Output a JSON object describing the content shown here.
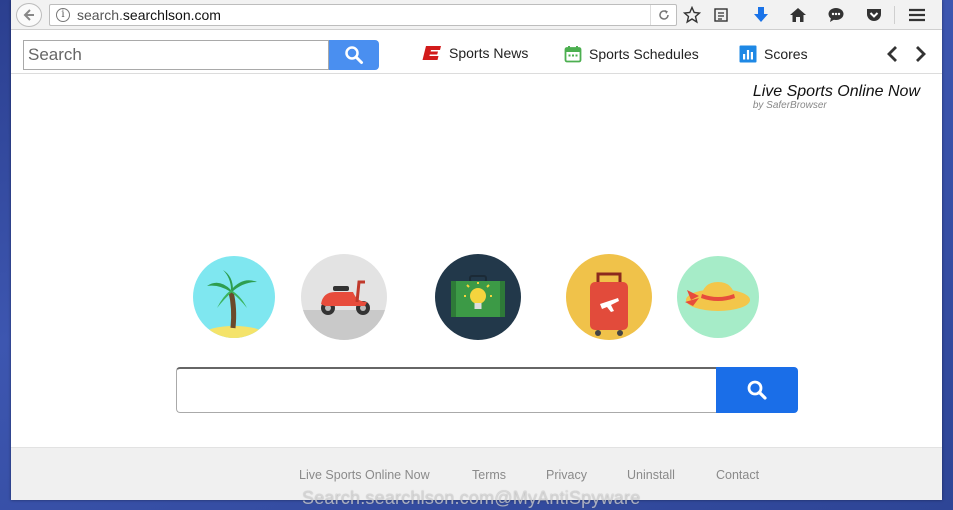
{
  "browser": {
    "url_prefix": "search.",
    "url_domain": "searchlson.com",
    "colors": {
      "download_arrow": "#1a73e8"
    }
  },
  "ext_toolbar": {
    "search_placeholder": "Search",
    "links": [
      {
        "label": "Sports News",
        "icon": "espn-logo-icon",
        "color": "#d21a1a"
      },
      {
        "label": "Sports Schedules",
        "icon": "calendar-icon",
        "color": "#4caf50"
      },
      {
        "label": "Scores",
        "icon": "bar-chart-icon",
        "color": "#1e88e5"
      }
    ]
  },
  "brand": {
    "title": "Live Sports Online Now",
    "subtitle": "by SaferBrowser"
  },
  "circles": [
    {
      "name": "palm-tree-icon",
      "bg": "#7fe7f0"
    },
    {
      "name": "scooter-icon",
      "bg": "#e3e3e3"
    },
    {
      "name": "suitcase-lightbulb-icon",
      "bg": "#22384a"
    },
    {
      "name": "luggage-airplane-icon",
      "bg": "#f0c24a"
    },
    {
      "name": "sun-hat-icon",
      "bg": "#a6ecc8"
    }
  ],
  "main_search": {
    "placeholder": ""
  },
  "footer": {
    "links": [
      "Live Sports Online Now",
      "Terms",
      "Privacy",
      "Uninstall",
      "Contact"
    ]
  },
  "watermark": "Search.searchlson.com@MyAntiSpyware"
}
